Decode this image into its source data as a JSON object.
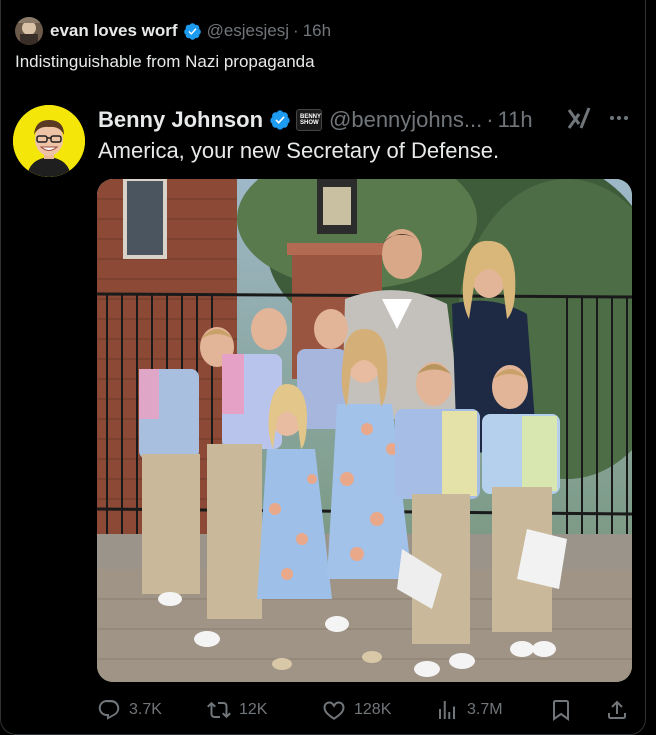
{
  "post": {
    "author_name": "evan loves worf",
    "author_handle": "@esjesjesj",
    "separator": "·",
    "time": "16h",
    "text": "Indistinguishable from Nazi propaganda"
  },
  "quoted": {
    "author_name": "Benny Johnson",
    "affiliate_badge_text": "BENNY SHOW",
    "author_handle": "@bennyjohns...",
    "separator": "·",
    "time": "11h",
    "text": "America, your new Secretary of Defense."
  },
  "actions": {
    "replies": "3.7K",
    "reposts": "12K",
    "likes": "128K",
    "views": "3.7M"
  },
  "colors": {
    "verified_blue": "#1d9bf0",
    "text_primary": "#e7e9ea",
    "text_secondary": "#71767b",
    "avatar_yellow": "#f5e60a"
  },
  "icons": [
    "verified-badge-icon",
    "grok-icon",
    "more-icon",
    "reply-icon",
    "repost-icon",
    "like-icon",
    "views-icon",
    "bookmark-icon",
    "share-icon"
  ]
}
